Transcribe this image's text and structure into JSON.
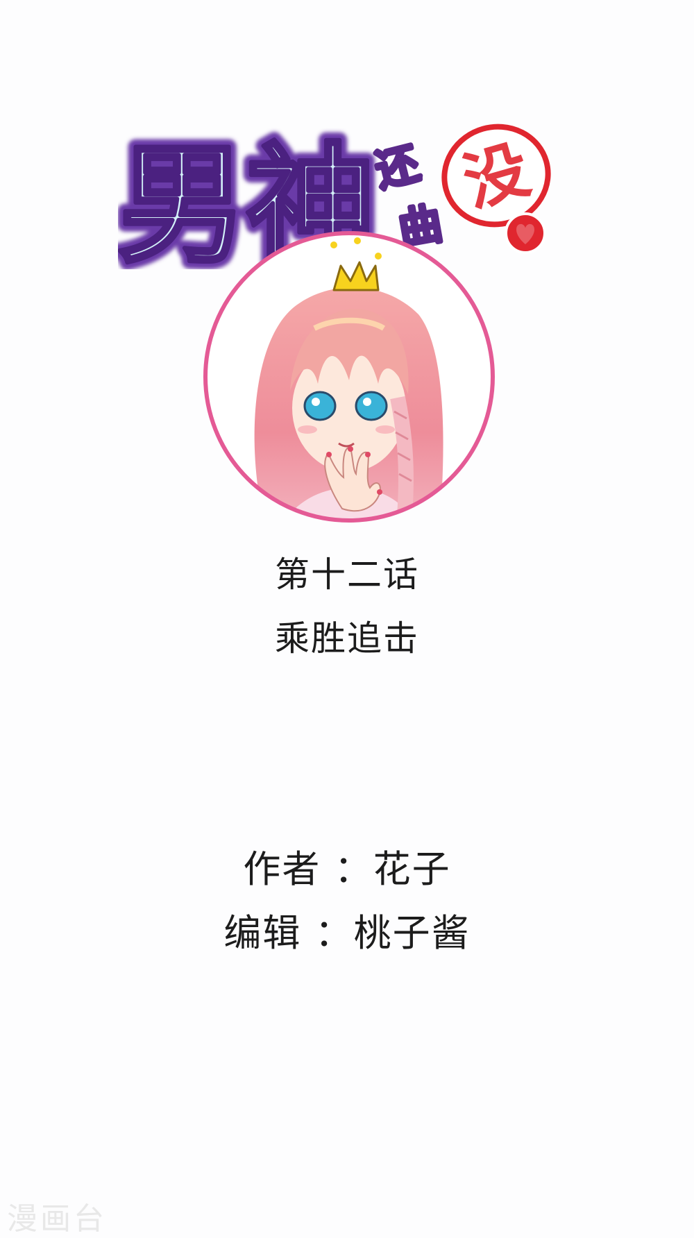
{
  "logo": {
    "title_big": "男神",
    "title_small_1": "还",
    "title_small_2": "曲",
    "seal_text": "没"
  },
  "chapter": {
    "number": "第十二话",
    "title": "乘胜追击"
  },
  "credits": {
    "author": "作者 ：花子",
    "editor": "编辑 ：桃子酱"
  },
  "watermark": "漫画台",
  "colors": {
    "title_fill": "#cfeef6",
    "title_outline": "#6a3aa8",
    "seal_red": "#e0262f",
    "frame_pink": "#e45a95",
    "hair_pink": "#f2a0a8",
    "crown_yellow": "#f7d21e",
    "eye_blue": "#3ab3d8",
    "text": "#1c1c1c"
  }
}
